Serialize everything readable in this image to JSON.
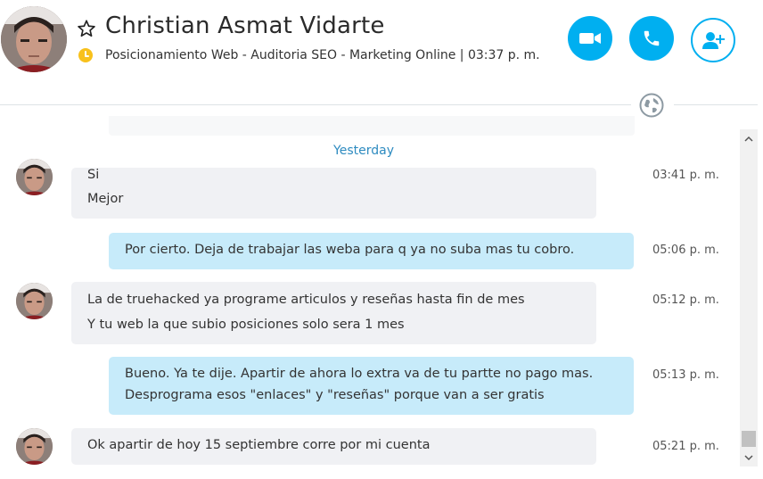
{
  "header": {
    "contact_name": "Christian Asmat Vidarte",
    "mood_message": "Posicionamiento Web  - Auditoria SEO  - Marketing Online  |  03:37 p. m.",
    "status_color": "#f8c11c",
    "icons": {
      "favorite": "star-outline-icon",
      "status": "away-clock-icon",
      "video": "video-camera-icon",
      "call": "phone-icon",
      "add_people": "add-person-icon",
      "translator": "globe-icon"
    },
    "accent_color": "#00aff0"
  },
  "chat": {
    "partial_previous": {
      "text": "",
      "time": ""
    },
    "day_separator": "Yesterday",
    "messages": [
      {
        "direction": "in",
        "lines": [
          "Si",
          "Mejor"
        ],
        "time": "03:41 p. m."
      },
      {
        "direction": "out",
        "lines": [
          "Por cierto. Deja de trabajar las weba para q ya no suba mas tu  cobro."
        ],
        "time": "05:06 p. m."
      },
      {
        "direction": "in",
        "lines": [
          "La de truehacked ya programe articulos y reseñas hasta fin de mes",
          "Y tu web la que subio posiciones solo sera 1 mes"
        ],
        "time": "05:12 p. m."
      },
      {
        "direction": "out",
        "lines": [
          "Bueno. Ya te dije. Apartir de ahora lo extra va de tu partte no pago mas.",
          "Desprograma esos \"enlaces\" y \"reseñas\" porque van a ser gratis"
        ],
        "time": "05:13 p. m."
      },
      {
        "direction": "in",
        "lines": [
          "Ok apartir de hoy 15 septiembre corre por mi cuenta"
        ],
        "time": "05:21 p. m."
      }
    ],
    "incoming_bubble_color": "#f0f1f4",
    "outgoing_bubble_color": "#c7ebfa"
  }
}
